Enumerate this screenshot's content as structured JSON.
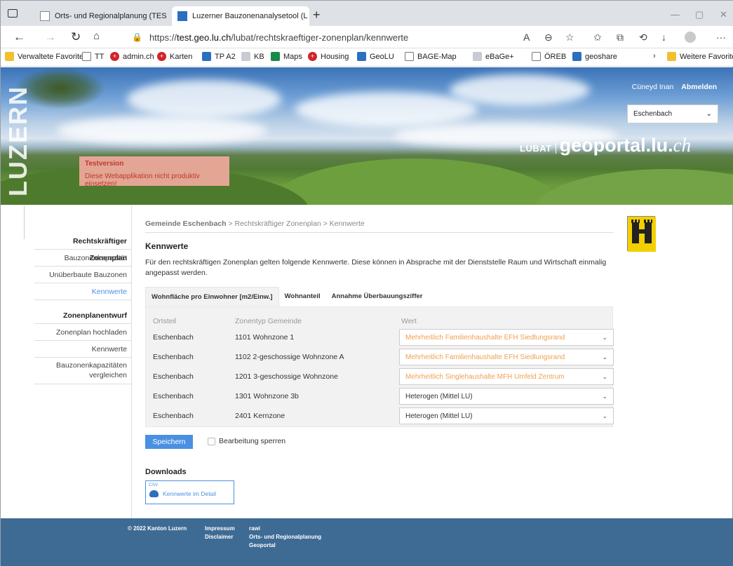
{
  "browser": {
    "tabs": [
      {
        "title": "Orts- und Regionalplanung (TES"
      },
      {
        "title": "Luzerner Bauzonenanalysetool (L"
      }
    ],
    "url_prefix": "https://",
    "url_host": "test.geo.lu.ch",
    "url_path": "/lubat/rechtskraeftiger-zonenplan/kennwerte",
    "favorites": [
      {
        "label": "Verwaltete Favoriten",
        "icon": "folder-icon"
      },
      {
        "label": "TT",
        "icon": "page-icon"
      },
      {
        "label": "admin.ch",
        "icon": "swiss-shield-icon"
      },
      {
        "label": "Karten",
        "icon": "swiss-shield-icon"
      },
      {
        "label": "TP A2",
        "icon": "app-icon"
      },
      {
        "label": "KB",
        "icon": "page-icon"
      },
      {
        "label": "Maps",
        "icon": "maps-pin-icon"
      },
      {
        "label": "Housing",
        "icon": "swiss-shield-icon"
      },
      {
        "label": "GeoLU",
        "icon": "app-icon"
      },
      {
        "label": "BAGE-Map",
        "icon": "page-icon"
      },
      {
        "label": "eBaGe+",
        "icon": "page-icon"
      },
      {
        "label": "ÖREB",
        "icon": "page-icon"
      },
      {
        "label": "geoshare",
        "icon": "app-icon"
      },
      {
        "label": "Weitere Favoriten",
        "icon": "folder-icon"
      }
    ]
  },
  "header": {
    "test_title": "Testversion",
    "test_text": "Diese Webapplikation nicht produktiv einsetzen!",
    "user_name": "Cüneyd Inan",
    "logout": "Abmelden",
    "municipality": "Eschenbach",
    "brand_lubat": "LUBAT",
    "brand_geoportal": "geoportal.lu.",
    "brand_ch": "ch",
    "luzern_vertical": "LUZERN"
  },
  "sidebar": {
    "section1_title": "Rechtskräftiger Zonenplan",
    "section1_items": [
      "Bauzonenkapazität",
      "Unüberbaute Bauzonen",
      "Kennwerte"
    ],
    "section2_title": "Zonenplanentwurf",
    "section2_items": [
      "Zonenplan hochladen",
      "Kennwerte",
      "Bauzonenkapazitäten vergleichen"
    ]
  },
  "main": {
    "breadcrumb_root": "Gemeinde Eschenbach",
    "breadcrumb_rest": " > Rechtskräftiger Zonenplan > Kennwerte",
    "title": "Kennwerte",
    "description": "Für den rechtskräftigen Zonenplan gelten folgende Kennwerte. Diese können in Absprache mit der Dienststelle Raum und Wirtschaft einmalig angepasst werden.",
    "tabs": [
      "Wohnfläche pro Einwohner [m2/Einw.]",
      "Wohnanteil",
      "Annahme Überbauungsziffer"
    ],
    "columns": [
      "Ortsteil",
      "Zonentyp Gemeinde",
      "Wert"
    ],
    "rows": [
      {
        "ortsteil": "Eschenbach",
        "zone": "1101 Wohnzone 1",
        "wert": "Mehrheitlich Familienhaushalte EFH Siedlungsrand"
      },
      {
        "ortsteil": "Eschenbach",
        "zone": "1102 2-geschossige Wohnzone A",
        "wert": "Mehrheitlich Familienhaushalte EFH Siedlungsrand"
      },
      {
        "ortsteil": "Eschenbach",
        "zone": "1201 3-geschossige Wohnzone",
        "wert": "Mehrheitlich Singlehaushalte MFH Umfeld Zentrum"
      },
      {
        "ortsteil": "Eschenbach",
        "zone": "1301 Wohnzone 3b",
        "wert": "Heterogen (Mittel LU)"
      },
      {
        "ortsteil": "Eschenbach",
        "zone": "2401 Kernzone",
        "wert": "Heterogen (Mittel LU)"
      }
    ],
    "save": "Speichern",
    "lock_label": "Bearbeitung sperren",
    "downloads_title": "Downloads",
    "csv_tag": "CSV",
    "csv_label": "Kennwerte im Detail"
  },
  "footer": {
    "copyright": "© 2022 Kanton Luzern",
    "links1": [
      "Impressum",
      "Disclaimer"
    ],
    "links2": [
      "rawi",
      "Orts- und Regionalplanung",
      "Geoportal"
    ]
  },
  "colors": {
    "accent": "#4a90e2",
    "footer": "#3e6b94",
    "warn_text": "#f0a050",
    "test_bg": "#f4aaa0"
  }
}
